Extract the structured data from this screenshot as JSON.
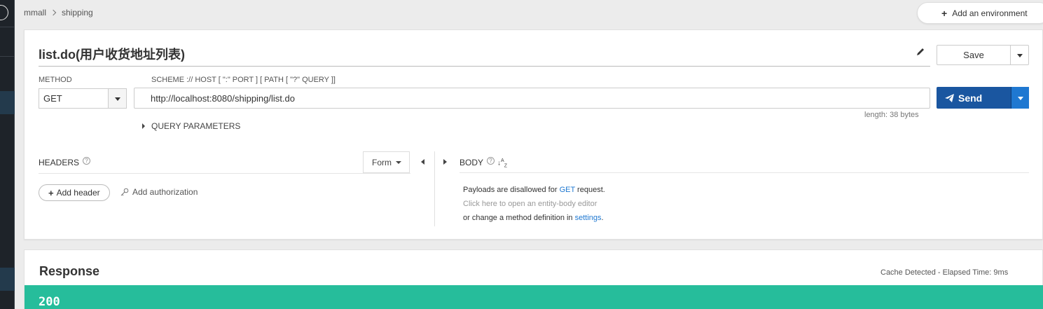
{
  "breadcrumb": {
    "root": "mmall",
    "current": "shipping"
  },
  "environment": {
    "add_label": "Add an environment"
  },
  "request": {
    "title": "list.do(用户收货地址列表)",
    "save_label": "Save",
    "method_label": "METHOD",
    "method_value": "GET",
    "url_label": "SCHEME :// HOST [ \":\" PORT ] [ PATH [ \"?\" QUERY ]]",
    "url_value": "http://localhost:8080/shipping/list.do",
    "send_label": "Send",
    "length_text": "length: 38 bytes",
    "query_parameters_label": "QUERY PARAMETERS"
  },
  "headers": {
    "label": "HEADERS",
    "form_label": "Form",
    "add_header_label": "Add header",
    "add_authorization_label": "Add authorization"
  },
  "body": {
    "label": "BODY",
    "line1_pre": "Payloads are disallowed for ",
    "line1_method": "GET",
    "line1_post": " request.",
    "line2": "Click here to open an entity-body editor",
    "line3_pre": "or change a method definition in ",
    "line3_link": "settings",
    "line3_post": "."
  },
  "response": {
    "title": "Response",
    "cache_text": "Cache Detected - Elapsed Time: 9ms",
    "status_code": "200"
  },
  "colors": {
    "send": "#1a56a0",
    "status_ok": "#26bd9b",
    "link": "#1f78d1"
  }
}
